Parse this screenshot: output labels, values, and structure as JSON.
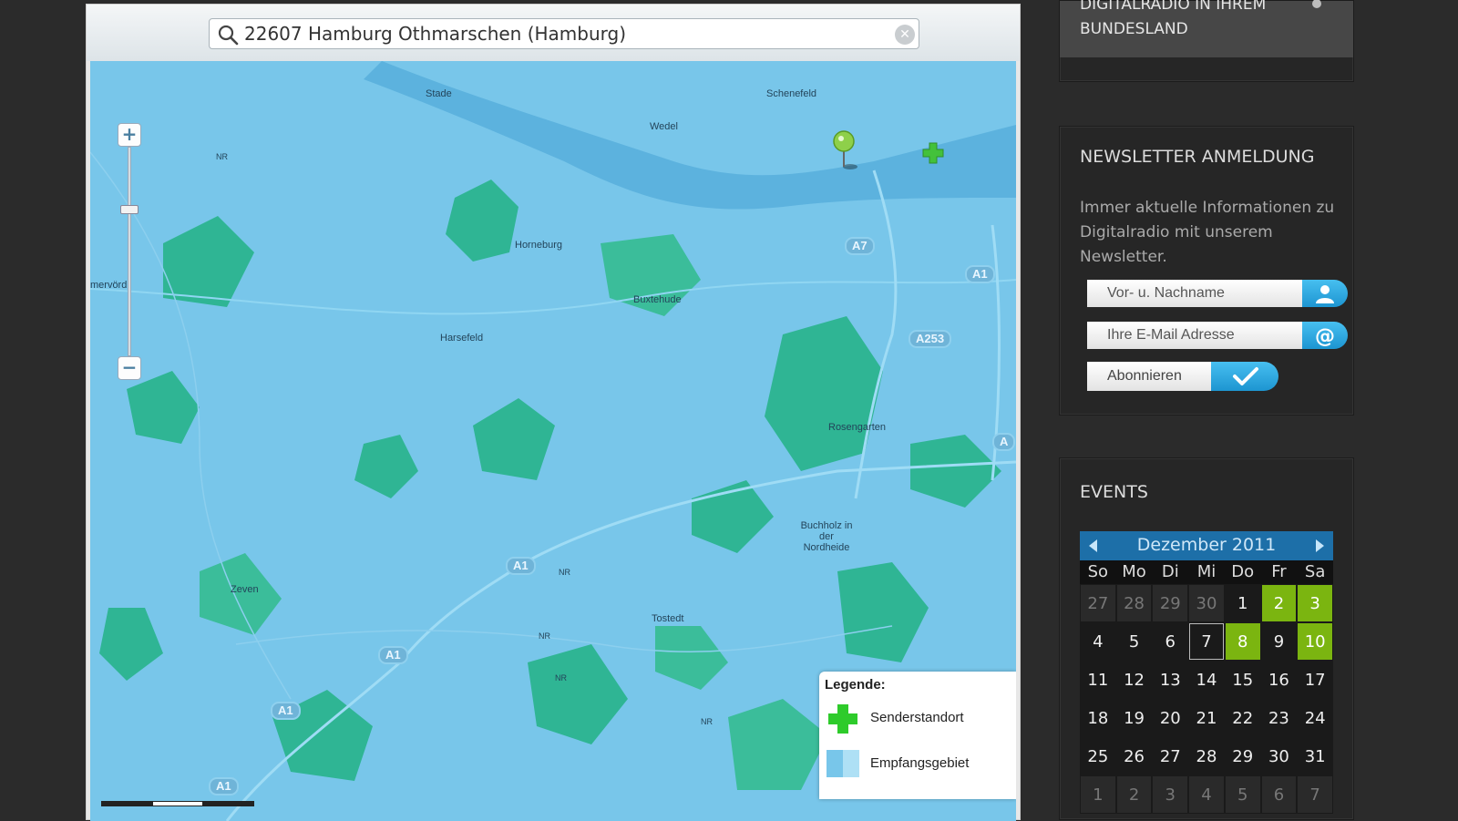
{
  "search": {
    "value": "22607 Hamburg Othmarschen (Hamburg)",
    "icon": "search-icon",
    "clear_icon": "clear-icon",
    "clear_symbol": "✕"
  },
  "map": {
    "zoom_in_symbol": "+",
    "zoom_out_symbol": "−",
    "places": [
      "Stade",
      "Schenefeld",
      "Wedel",
      "Horneburg",
      "Buxtehude",
      "Harsefeld",
      "Rosengarten",
      "Buchholz in der Nordheide",
      "Zeven",
      "Tostedt",
      "NR",
      "NR",
      "NR",
      "NR",
      "NR",
      "mervörd"
    ],
    "roads": [
      "A7",
      "A1",
      "A253",
      "A1",
      "A1",
      "A1",
      "A1",
      "A",
      "A1"
    ],
    "legend": {
      "title": "Legende:",
      "items": [
        {
          "label": "Senderstandort",
          "icon": "green-cross-icon"
        },
        {
          "label": "Empfangsgebiet",
          "icon": "reception-area-swatch"
        }
      ]
    },
    "colors": {
      "reception_area": "#78c6ea",
      "forest": "#2fb594",
      "transmitter": "#43c13b"
    }
  },
  "sidebar": {
    "bundesland": {
      "text": "DIGITALRADIO IN IHREM BUNDESLAND"
    },
    "newsletter": {
      "title": "NEWSLETTER ANMELDUNG",
      "description": "Immer aktuelle Informationen zu Digitalradio mit unserem Newsletter.",
      "name_placeholder": "Vor- u. Nachname",
      "email_placeholder": "Ihre E-Mail Adresse",
      "subscribe_label": "Abonnieren",
      "name_icon": "person-icon",
      "email_icon": "at-sign-icon",
      "subscribe_icon": "checkmark-icon"
    },
    "events": {
      "title": "EVENTS",
      "month": "Dezember 2011",
      "weekdays": [
        "So",
        "Mo",
        "Di",
        "Mi",
        "Do",
        "Fr",
        "Sa"
      ],
      "days": [
        {
          "d": "27",
          "s": "other"
        },
        {
          "d": "28",
          "s": "other"
        },
        {
          "d": "29",
          "s": "other"
        },
        {
          "d": "30",
          "s": "other"
        },
        {
          "d": "1",
          "s": ""
        },
        {
          "d": "2",
          "s": "event"
        },
        {
          "d": "3",
          "s": "event"
        },
        {
          "d": "4",
          "s": ""
        },
        {
          "d": "5",
          "s": ""
        },
        {
          "d": "6",
          "s": ""
        },
        {
          "d": "7",
          "s": "today"
        },
        {
          "d": "8",
          "s": "event"
        },
        {
          "d": "9",
          "s": ""
        },
        {
          "d": "10",
          "s": "event"
        },
        {
          "d": "11",
          "s": ""
        },
        {
          "d": "12",
          "s": ""
        },
        {
          "d": "13",
          "s": ""
        },
        {
          "d": "14",
          "s": ""
        },
        {
          "d": "15",
          "s": ""
        },
        {
          "d": "16",
          "s": ""
        },
        {
          "d": "17",
          "s": ""
        },
        {
          "d": "18",
          "s": ""
        },
        {
          "d": "19",
          "s": ""
        },
        {
          "d": "20",
          "s": ""
        },
        {
          "d": "21",
          "s": ""
        },
        {
          "d": "22",
          "s": ""
        },
        {
          "d": "23",
          "s": ""
        },
        {
          "d": "24",
          "s": ""
        },
        {
          "d": "25",
          "s": ""
        },
        {
          "d": "26",
          "s": ""
        },
        {
          "d": "27",
          "s": ""
        },
        {
          "d": "28",
          "s": ""
        },
        {
          "d": "29",
          "s": ""
        },
        {
          "d": "30",
          "s": ""
        },
        {
          "d": "31",
          "s": ""
        },
        {
          "d": "1",
          "s": "other"
        },
        {
          "d": "2",
          "s": "other"
        },
        {
          "d": "3",
          "s": "other"
        },
        {
          "d": "4",
          "s": "other"
        },
        {
          "d": "5",
          "s": "other"
        },
        {
          "d": "6",
          "s": "other"
        },
        {
          "d": "7",
          "s": "other"
        }
      ],
      "event_color": "#7bb510",
      "header_color": "#1d6fa8"
    }
  }
}
